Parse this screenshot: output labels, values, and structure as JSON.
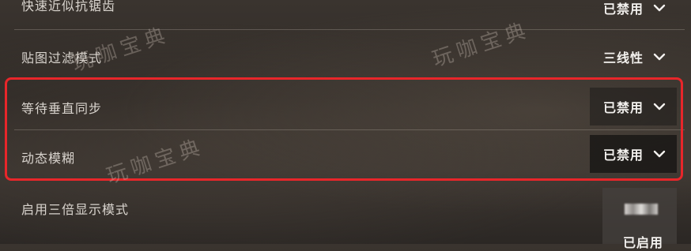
{
  "settings": [
    {
      "label": "快速近似抗锯齿",
      "value": "已禁用"
    },
    {
      "label": "贴图过滤模式",
      "value": "三线性"
    },
    {
      "label": "等待垂直同步",
      "value": "已禁用"
    },
    {
      "label": "动态模糊",
      "value": "已禁用"
    },
    {
      "label": "启用三倍显示模式",
      "value": "已启用"
    }
  ],
  "watermark": "玩咖宝典",
  "colors": {
    "highlight_border": "#e8262a",
    "background": "#34302b"
  },
  "icons": {
    "dropdown": "chevron-down-icon"
  }
}
